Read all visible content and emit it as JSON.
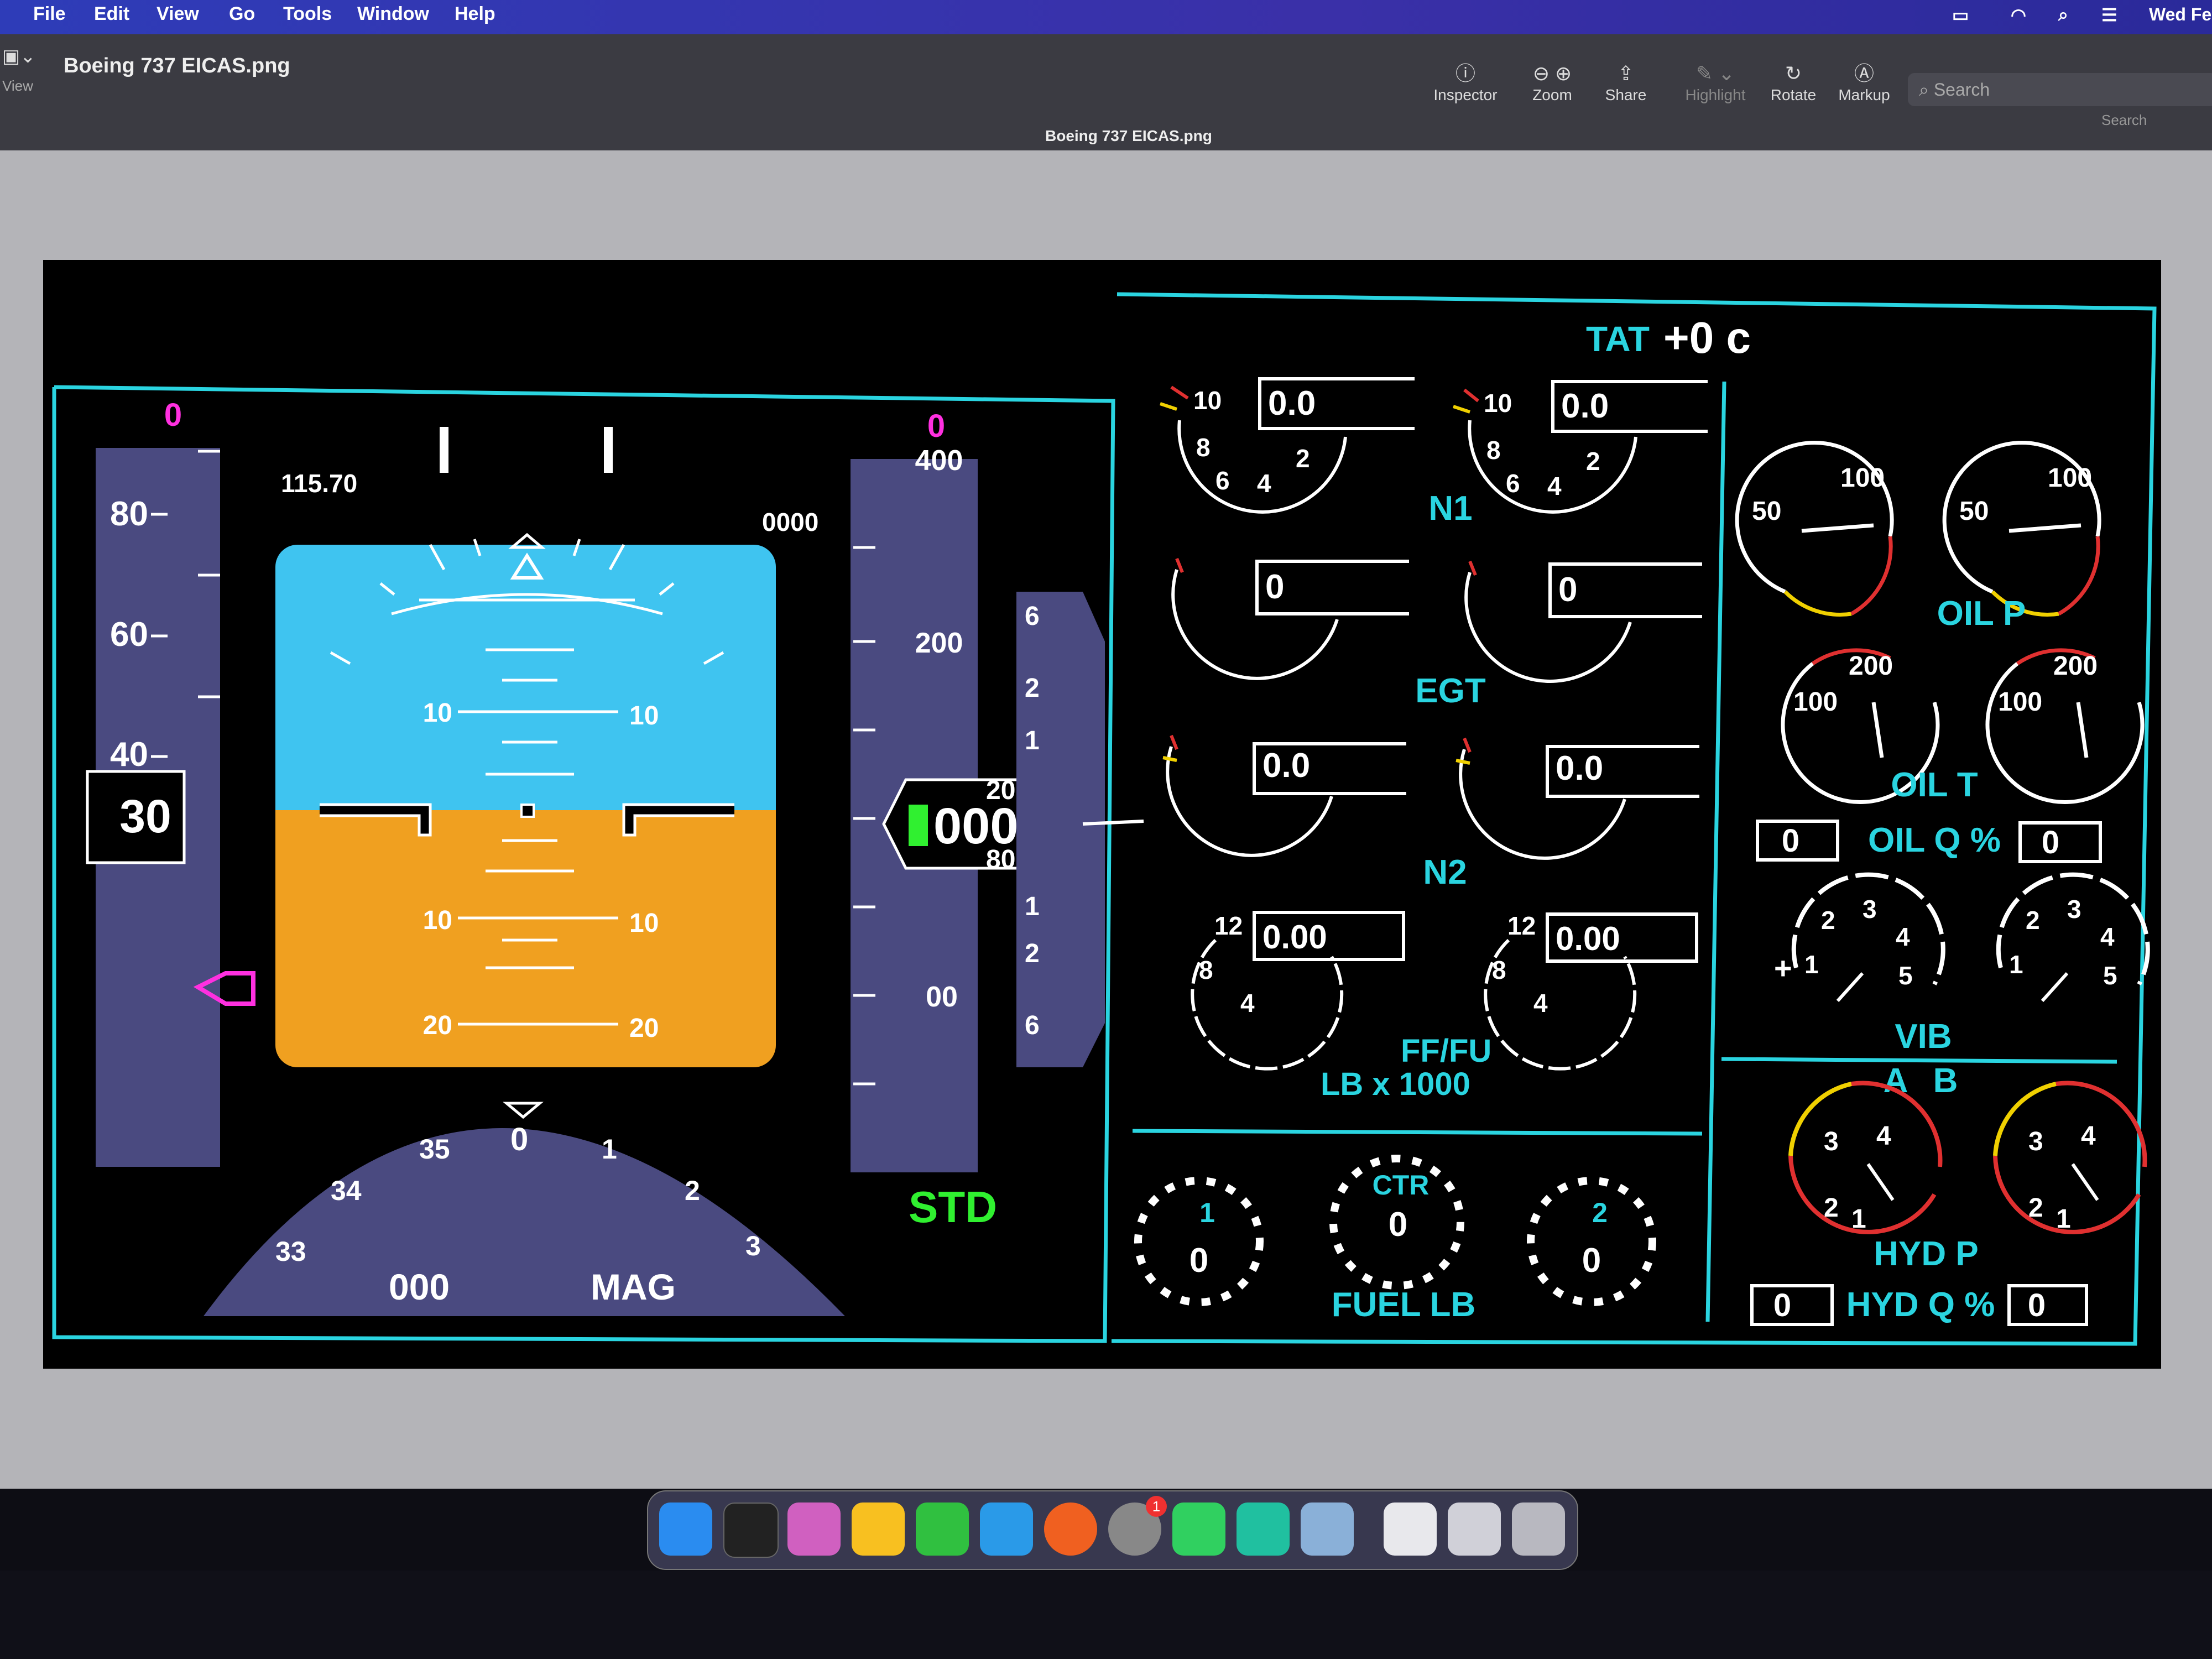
{
  "menubar": {
    "items": [
      "File",
      "Edit",
      "View",
      "Go",
      "Tools",
      "Window",
      "Help"
    ],
    "clock": "Wed Fe"
  },
  "toolbar": {
    "filename": "Boeing 737 EICAS.png",
    "view_label": "View",
    "buttons": [
      {
        "label": "Inspector",
        "icon": "info-icon"
      },
      {
        "label": "Zoom",
        "icon": "zoom-icon"
      },
      {
        "label": "Share",
        "icon": "share-icon"
      },
      {
        "label": "Highlight",
        "icon": "highlight-icon"
      },
      {
        "label": "Rotate",
        "icon": "rotate-icon"
      },
      {
        "label": "Markup",
        "icon": "markup-icon"
      }
    ],
    "center_title": "Boeing 737 EICAS.png",
    "search_placeholder": "Search",
    "search_label": "Search"
  },
  "pfd": {
    "speed_target": "0",
    "speed_ticks": [
      "80",
      "60",
      "40"
    ],
    "speed_current": "30",
    "nav_freq": "115.70",
    "dme": "0000",
    "pitch_labels": [
      "10",
      "10",
      "10",
      "10",
      "20",
      "20"
    ],
    "alt_target": "0",
    "alt_labels": [
      "400",
      "200",
      "00"
    ],
    "alt_current": "0000",
    "alt_roll": [
      "20",
      "80"
    ],
    "baro": "STD",
    "vs_labels": [
      "6",
      "2",
      "1",
      "1",
      "2",
      "6"
    ],
    "heading_labels": [
      "33",
      "34",
      "35",
      "0",
      "1",
      "2",
      "3"
    ],
    "heading_value": "000",
    "heading_mode": "MAG"
  },
  "eicas": {
    "tat_label": "TAT",
    "tat_value": "+0 c",
    "n1": {
      "label": "N1",
      "left": "0.0",
      "right": "0.0",
      "scale": [
        "10",
        "8",
        "6",
        "4",
        "2"
      ]
    },
    "egt": {
      "label": "EGT",
      "left": "0",
      "right": "0"
    },
    "n2": {
      "label": "N2",
      "left": "0.0",
      "right": "0.0"
    },
    "ff": {
      "label": "FF/FU",
      "sublabel": "LB x 1000",
      "left": "0.00",
      "right": "0.00",
      "scale": [
        "12",
        "8",
        "4"
      ]
    },
    "fuel": {
      "label": "FUEL LB",
      "ctr": "CTR",
      "tank1": "1",
      "tank2": "2",
      "left": "0",
      "center": "0",
      "right": "0"
    },
    "oil_p": {
      "label": "OIL P",
      "scale": [
        "50",
        "100"
      ]
    },
    "oil_t": {
      "label": "OIL T",
      "scale": [
        "100",
        "200"
      ]
    },
    "oil_q": {
      "label": "OIL Q %",
      "left": "0",
      "right": "0"
    },
    "vib": {
      "label": "VIB",
      "scale": [
        "1",
        "2",
        "3",
        "4",
        "5"
      ]
    },
    "hyd": {
      "label": "HYD P",
      "ab_a": "A",
      "ab_b": "B",
      "scale": [
        "2",
        "3",
        "4",
        "1"
      ]
    },
    "hyd_q": {
      "label": "HYD Q %",
      "left": "0",
      "right": "0"
    }
  },
  "dock": {
    "icons": [
      "finder-icon",
      "terminal-icon",
      "launchpad-icon",
      "notes-icon",
      "numbers-icon",
      "keynote-icon",
      "firefox-icon",
      "settings-icon",
      "pycharm-icon",
      "clion-icon",
      "preview-icon",
      "documents-icon",
      "downloads-icon",
      "trash-icon"
    ],
    "settings_badge": "1"
  },
  "colors": {
    "cyan": "#2ad4e0",
    "sky": "#3fc4f0",
    "ground": "#f0a020",
    "tape": "#4a4a80",
    "magenta": "#ff30e0",
    "green": "#30f030",
    "white": "#ffffff"
  }
}
